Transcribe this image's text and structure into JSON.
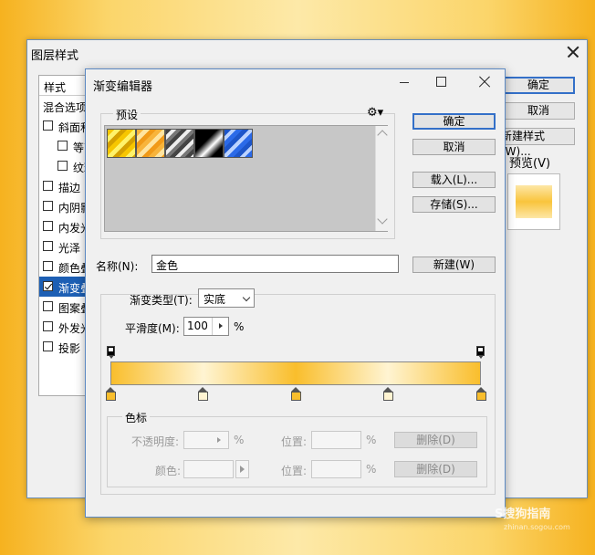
{
  "layer_style": {
    "title": "图层样式",
    "list_header": "样式",
    "items": [
      {
        "label": "混合选项",
        "checkbox": false,
        "checked": false,
        "indent": 0,
        "selected": false
      },
      {
        "label": "斜面和浮雕",
        "checkbox": true,
        "checked": false,
        "indent": 0,
        "selected": false
      },
      {
        "label": "等高线",
        "checkbox": true,
        "checked": false,
        "indent": 1,
        "selected": false
      },
      {
        "label": "纹理",
        "checkbox": true,
        "checked": false,
        "indent": 1,
        "selected": false
      },
      {
        "label": "描边",
        "checkbox": true,
        "checked": false,
        "indent": 0,
        "selected": false
      },
      {
        "label": "内阴影",
        "checkbox": true,
        "checked": false,
        "indent": 0,
        "selected": false
      },
      {
        "label": "内发光",
        "checkbox": true,
        "checked": false,
        "indent": 0,
        "selected": false
      },
      {
        "label": "光泽",
        "checkbox": true,
        "checked": false,
        "indent": 0,
        "selected": false
      },
      {
        "label": "颜色叠加",
        "checkbox": true,
        "checked": false,
        "indent": 0,
        "selected": false
      },
      {
        "label": "渐变叠加",
        "checkbox": true,
        "checked": true,
        "indent": 0,
        "selected": true
      },
      {
        "label": "图案叠加",
        "checkbox": true,
        "checked": false,
        "indent": 0,
        "selected": false
      },
      {
        "label": "外发光",
        "checkbox": true,
        "checked": false,
        "indent": 0,
        "selected": false
      },
      {
        "label": "投影",
        "checkbox": true,
        "checked": false,
        "indent": 0,
        "selected": false
      }
    ],
    "ok": "确定",
    "cancel": "取消",
    "new_style": "新建样式(W)...",
    "preview": "预览(V)"
  },
  "gradient_editor": {
    "title": "渐变编辑器",
    "presets_label": "预设",
    "ok": "确定",
    "cancel": "取消",
    "load": "载入(L)...",
    "save": "存储(S)...",
    "name_label": "名称(N):",
    "name_value": "金色",
    "new": "新建(W)",
    "gradient_type_label": "渐变类型(T):",
    "gradient_type_value": "实底",
    "smoothness_label": "平滑度(M):",
    "smoothness_value": "100",
    "smoothness_unit": "%",
    "stops_group": "色标",
    "opacity_label": "不透明度:",
    "opacity_unit": "%",
    "location_label": "位置:",
    "location_unit": "%",
    "delete": "删除(D)",
    "color_label": "颜色:",
    "gradient_stops": [
      {
        "location": 0,
        "color": "#f9be2c"
      },
      {
        "location": 25,
        "color": "#fff4d2"
      },
      {
        "location": 50,
        "color": "#f9be2c"
      },
      {
        "location": 75,
        "color": "#fff4d2"
      },
      {
        "location": 100,
        "color": "#f9be2c"
      }
    ]
  },
  "watermark": {
    "text": "S搜狗指南",
    "url": "zhinan.sogou.com"
  }
}
